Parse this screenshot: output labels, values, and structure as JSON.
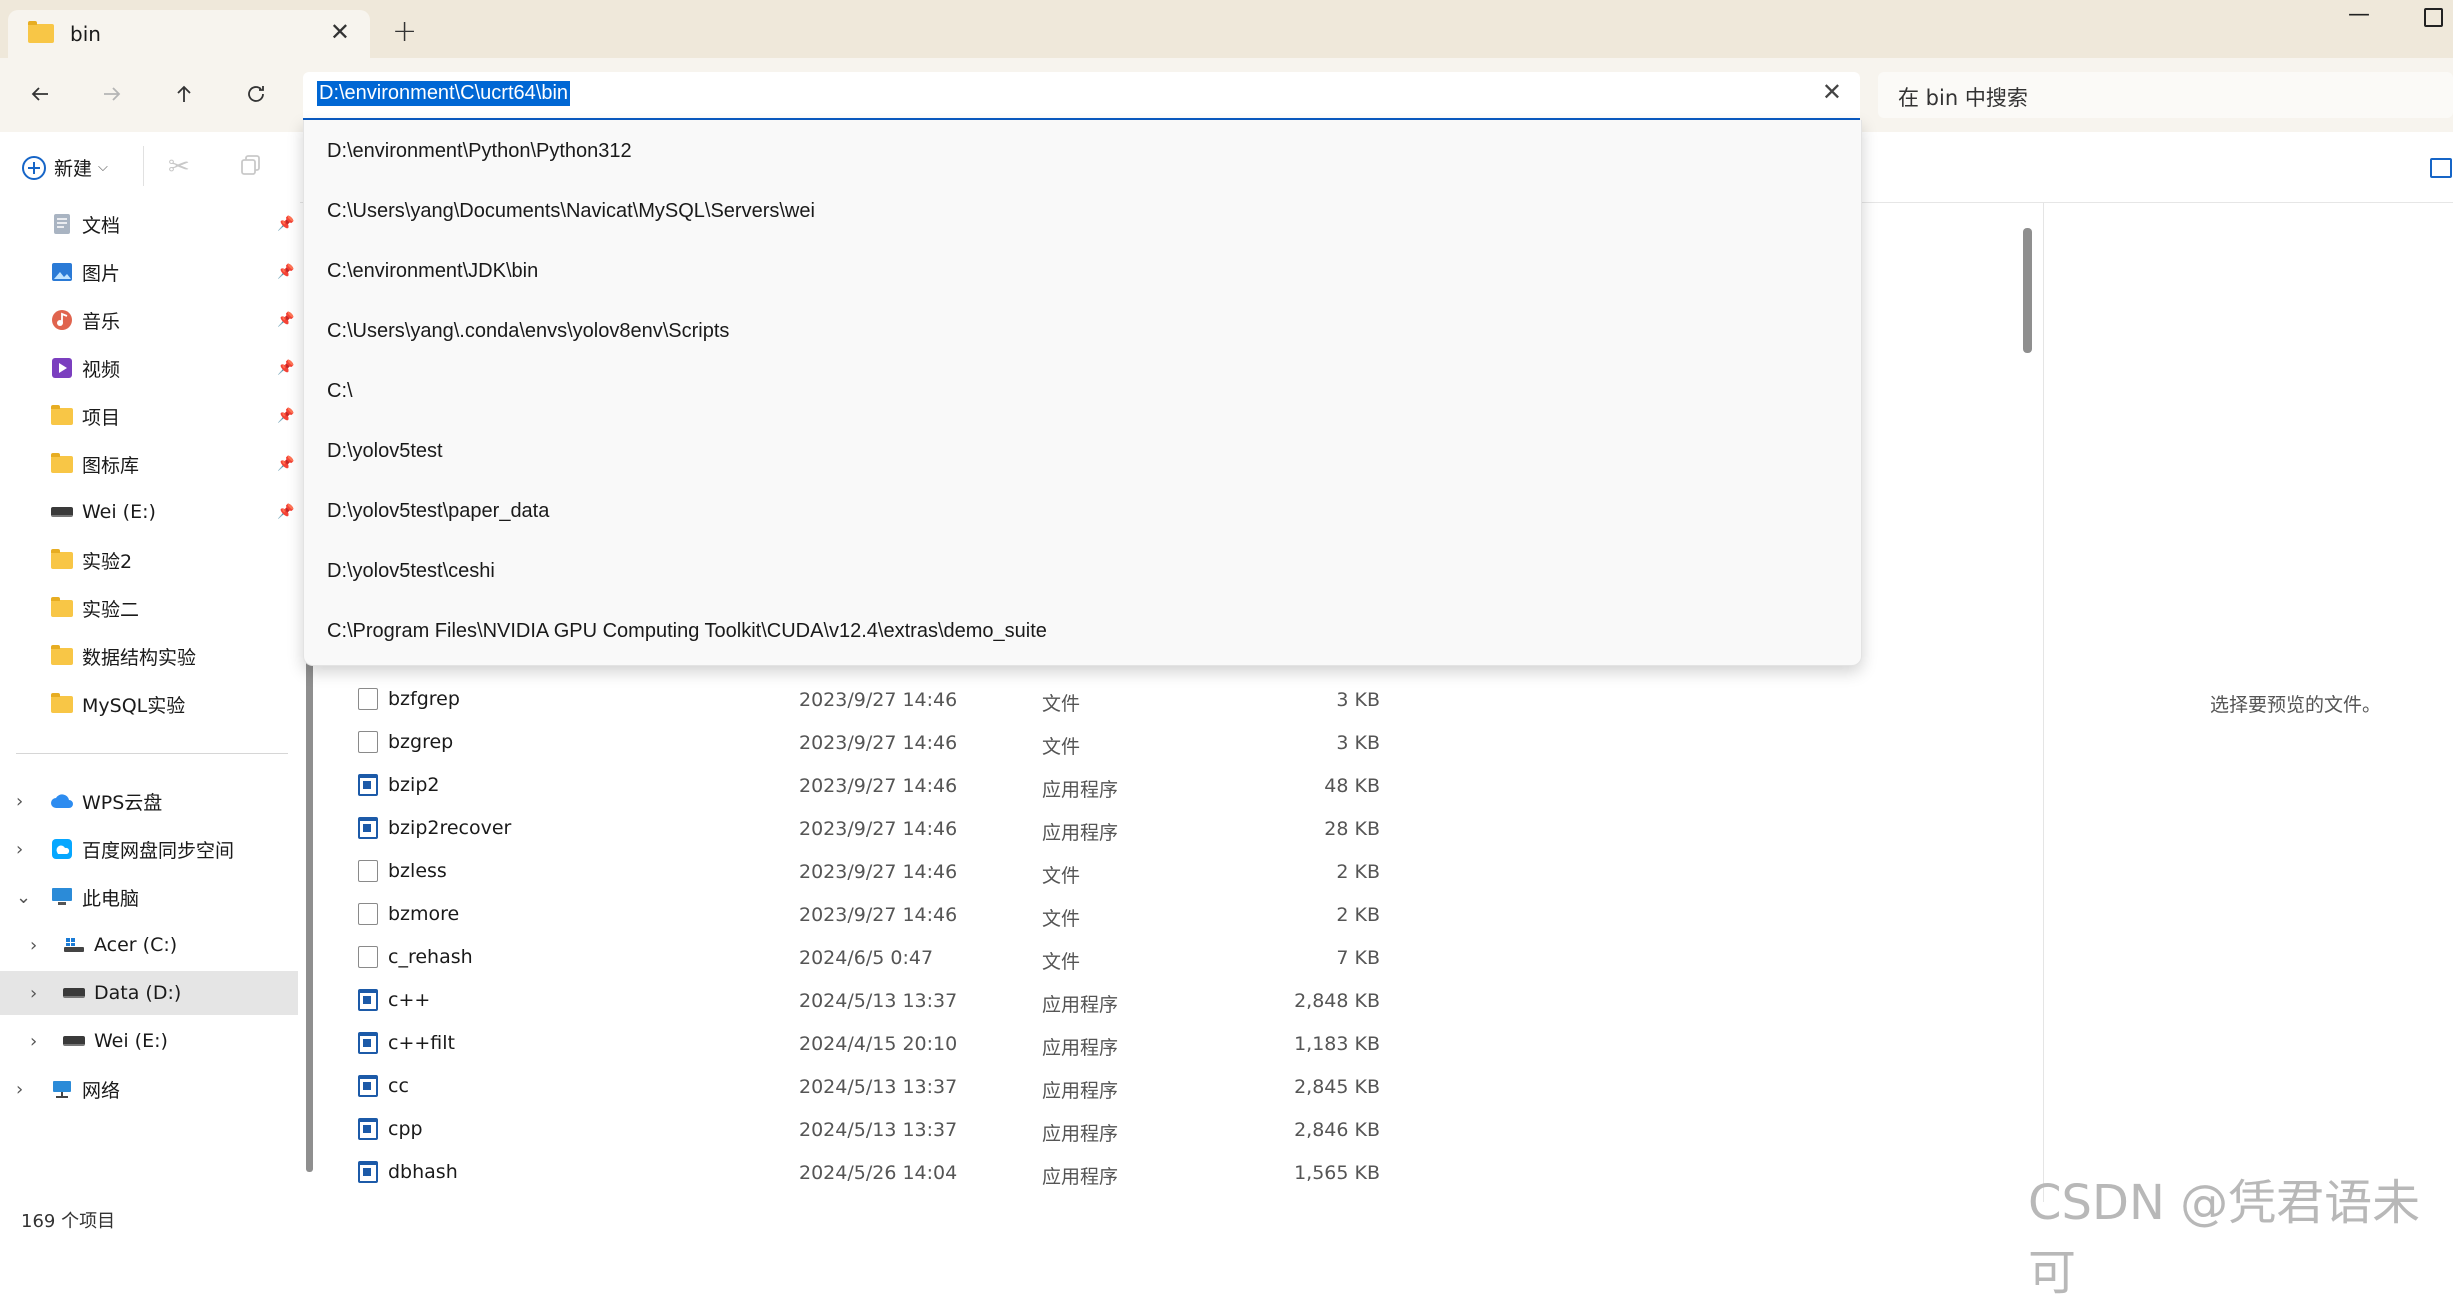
{
  "tab": {
    "title": "bin"
  },
  "address": {
    "value": "D:\\environment\\C\\ucrt64\\bin"
  },
  "search": {
    "placeholder": "在 bin 中搜索"
  },
  "toolbar": {
    "new_label": "新建"
  },
  "sidebar": {
    "quick_access": [
      {
        "label": "文档",
        "icon": "documents-icon"
      },
      {
        "label": "图片",
        "icon": "pictures-icon"
      },
      {
        "label": "音乐",
        "icon": "music-icon"
      },
      {
        "label": "视频",
        "icon": "videos-icon"
      },
      {
        "label": "项目",
        "icon": "folder-icon"
      },
      {
        "label": "图标库",
        "icon": "folder-icon"
      },
      {
        "label": "Wei (E:)",
        "icon": "drive-icon"
      },
      {
        "label": "实验2",
        "icon": "folder-icon"
      },
      {
        "label": "实验二",
        "icon": "folder-icon"
      },
      {
        "label": "数据结构实验",
        "icon": "folder-icon"
      },
      {
        "label": "MySQL实验",
        "icon": "folder-icon"
      }
    ],
    "tree": [
      {
        "label": "WPS云盘",
        "icon": "wps-cloud-icon"
      },
      {
        "label": "百度网盘同步空间",
        "icon": "baidu-netdisk-icon"
      },
      {
        "label": "此电脑",
        "icon": "this-pc-icon"
      },
      {
        "label": "Acer (C:)",
        "icon": "windows-drive-icon"
      },
      {
        "label": "Data (D:)",
        "icon": "drive-icon"
      },
      {
        "label": "Wei (E:)",
        "icon": "drive-icon"
      },
      {
        "label": "网络",
        "icon": "network-icon"
      }
    ]
  },
  "dropdown": {
    "items": [
      "D:\\environment\\Python\\Python312",
      "C:\\Users\\yang\\Documents\\Navicat\\MySQL\\Servers\\wei",
      "C:\\environment\\JDK\\bin",
      "C:\\Users\\yang\\.conda\\envs\\yolov8env\\Scripts",
      "C:\\",
      "D:\\yolov5test",
      "D:\\yolov5test\\paper_data",
      "D:\\yolov5test\\ceshi",
      "C:\\Program Files\\NVIDIA GPU Computing Toolkit\\CUDA\\v12.4\\extras\\demo_suite"
    ]
  },
  "files": [
    {
      "name": "bzfgrep",
      "date": "2023/9/27 14:46",
      "type": "文件",
      "size": "3 KB",
      "kind": "file"
    },
    {
      "name": "bzgrep",
      "date": "2023/9/27 14:46",
      "type": "文件",
      "size": "3 KB",
      "kind": "file"
    },
    {
      "name": "bzip2",
      "date": "2023/9/27 14:46",
      "type": "应用程序",
      "size": "48 KB",
      "kind": "app"
    },
    {
      "name": "bzip2recover",
      "date": "2023/9/27 14:46",
      "type": "应用程序",
      "size": "28 KB",
      "kind": "app"
    },
    {
      "name": "bzless",
      "date": "2023/9/27 14:46",
      "type": "文件",
      "size": "2 KB",
      "kind": "file"
    },
    {
      "name": "bzmore",
      "date": "2023/9/27 14:46",
      "type": "文件",
      "size": "2 KB",
      "kind": "file"
    },
    {
      "name": "c_rehash",
      "date": "2024/6/5 0:47",
      "type": "文件",
      "size": "7 KB",
      "kind": "file"
    },
    {
      "name": "c++",
      "date": "2024/5/13 13:37",
      "type": "应用程序",
      "size": "2,848 KB",
      "kind": "app"
    },
    {
      "name": "c++filt",
      "date": "2024/4/15 20:10",
      "type": "应用程序",
      "size": "1,183 KB",
      "kind": "app"
    },
    {
      "name": "cc",
      "date": "2024/5/13 13:37",
      "type": "应用程序",
      "size": "2,845 KB",
      "kind": "app"
    },
    {
      "name": "cpp",
      "date": "2024/5/13 13:37",
      "type": "应用程序",
      "size": "2,846 KB",
      "kind": "app"
    },
    {
      "name": "dbhash",
      "date": "2024/5/26 14:04",
      "type": "应用程序",
      "size": "1,565 KB",
      "kind": "app"
    }
  ],
  "preview": {
    "text": "选择要预览的文件。"
  },
  "status": {
    "text": "169 个项目"
  },
  "watermark": {
    "text": "CSDN @凭君语未可"
  },
  "colors": {
    "accent": "#0067d4",
    "folder": "#f8c646",
    "titlebar": "#efe8da"
  }
}
